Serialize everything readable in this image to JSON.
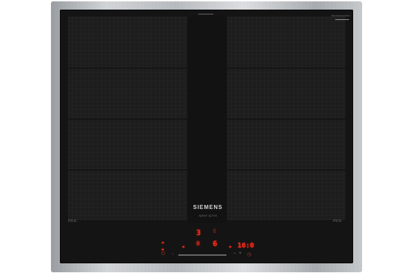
{
  "brand": "SIEMENS",
  "series_label": "iQ500 iQ700",
  "corner_badge": "flexInduction",
  "zone_left_label": "PR A-",
  "zone_right_label": "PR A-",
  "display": {
    "front_left_level": "3",
    "front_left_aux": "0",
    "rear_left_level": "0",
    "rear_right_level": "6",
    "timer": "16:0"
  },
  "colors": {
    "glass": "#141414",
    "led": "#ff2a1a",
    "frame": "#c2c5c8"
  },
  "icons": [
    "power-icon",
    "lock-icon",
    "timer-icon",
    "plus-icon",
    "minus-icon"
  ]
}
